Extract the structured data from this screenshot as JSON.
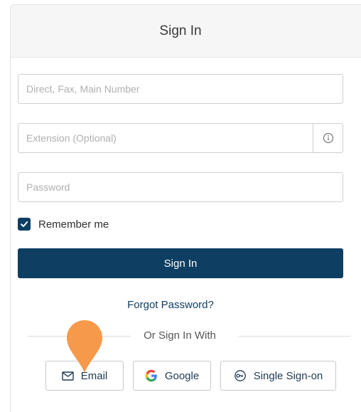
{
  "header": {
    "title": "Sign In"
  },
  "form": {
    "phone_placeholder": "Direct, Fax, Main Number",
    "extension_placeholder": "Extension (Optional)",
    "password_placeholder": "Password",
    "remember_label": "Remember me",
    "remember_checked": true,
    "signin_label": "Sign In",
    "forgot_label": "Forgot Password?"
  },
  "alt_signin": {
    "divider_label": "Or Sign In With",
    "buttons": [
      {
        "label": "Email",
        "icon": "envelope-icon"
      },
      {
        "label": "Google",
        "icon": "google-icon"
      },
      {
        "label": "Single Sign-on",
        "icon": "key-icon"
      }
    ]
  },
  "colors": {
    "primary": "#0e3e62",
    "marker": "#f7994a",
    "header_bg": "#f6f6f6"
  }
}
